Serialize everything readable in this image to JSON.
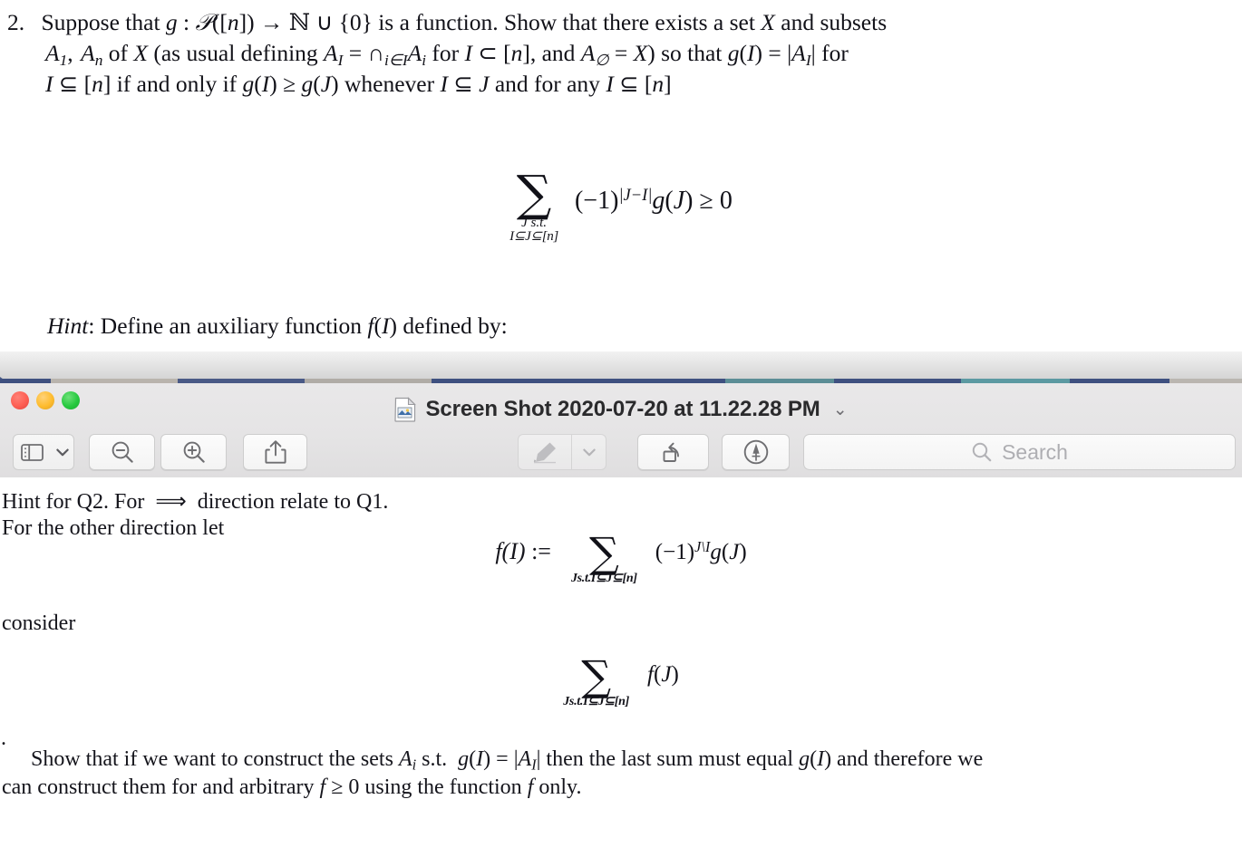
{
  "document_upper": {
    "problem_number": "2.",
    "line1": "Suppose that g : P([n]) → N ∪ {0} is a function. Show that there exists a set X and subsets",
    "line2": "A₁,… Aₙ of X (as usual defining A_I = ∩_{i∈I} A_i for I ⊂ [n], and A_∅ = X) so that g(I) = |A_I| for",
    "line3": "I ⊆ [n] if and only if g(I) ≥ g(J) whenever I ⊆ J and for any I ⊆ [n]",
    "equation1": {
      "sum_glyph": "∑",
      "sum_sub_row1": "J s.t.",
      "sum_sub_row2": "I⊆J⊆[n]",
      "body": "(−1)^{|J−I|} g(J) ≥ 0"
    },
    "hint_label": "Hint",
    "hint_text": ": Define an auxiliary function f(I) defined by:"
  },
  "window": {
    "title": "Screen Shot 2020-07-20 at 11.22.28 PM",
    "title_chevron": "⌄",
    "traffic_lights": [
      {
        "name": "close",
        "color": "#fd5e53"
      },
      {
        "name": "minimize",
        "color": "#febc2e"
      },
      {
        "name": "zoom",
        "color": "#27c93f"
      }
    ],
    "toolbar": {
      "sidebar_button": "sidebar-view-button",
      "sidebar_chevron": "⌄",
      "zoom_out_button": "zoom-out-button",
      "zoom_in_button": "zoom-in-button",
      "share_button": "share-button",
      "markup_pen_button": "markup-pen-button",
      "markup_pen_chevron": "⌄",
      "rotate_button": "rotate-left-button",
      "annotate_button": "show-markup-toolbar-button"
    },
    "search": {
      "placeholder": "Search",
      "value": ""
    }
  },
  "document_lower": {
    "line_a": "Hint for Q2. For ⟹ direction relate to Q1.",
    "line_b": "For the other direction let",
    "equation2": {
      "lead": "f(I) :=",
      "sum_glyph": "∑",
      "sum_sub": "J s.t. I⊆J⊆[n]",
      "body": "(−1)^{J∖I} g(J)"
    },
    "line_c": "consider",
    "equation3": {
      "sum_glyph": "∑",
      "sum_sub": "J s.t. I⊆J⊆[n]",
      "body": "f(J)"
    },
    "stray_dot": ".",
    "line_e": "Show that if we want to construct the sets A_i s.t.  g(I) = |A_I| then the last sum must equal g(I) and therefore we",
    "line_f": "can construct them for and arbitrary f ≥ 0 using the function f only."
  },
  "colors": {
    "page_background": "#ffffff",
    "window_chrome": "#e5e4e5",
    "window_body": "#e3e3e5",
    "text": "#15151c",
    "placeholder": "#aeaeb2",
    "accent_blue": "#3f5180"
  }
}
